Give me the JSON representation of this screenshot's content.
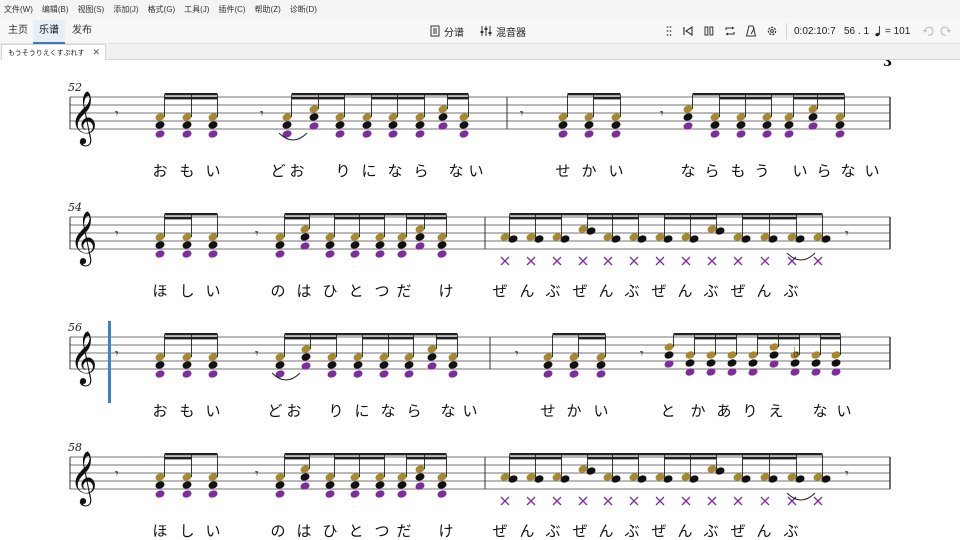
{
  "menubar": [
    "文件(W)",
    "编辑(B)",
    "视图(S)",
    "添加(J)",
    "格式(G)",
    "工具(J)",
    "插件(C)",
    "帮助(Z)",
    "诊断(D)"
  ],
  "tabs": [
    {
      "label": "主页",
      "active": false
    },
    {
      "label": "乐谱",
      "active": true
    },
    {
      "label": "发布",
      "active": false
    }
  ],
  "toolbar": {
    "parts_label": "分谱",
    "mixer_label": "混音器",
    "time": "0:02:10:7",
    "position": "56 . 1",
    "tempo": "= 101"
  },
  "document_tab": {
    "title": "もうそうりえくすぷれす"
  },
  "colors": {
    "note_black": "#111111",
    "note_olive": "#a8882e",
    "note_purple": "#7f2d9d",
    "playhead": "#3d82c7",
    "accent": "#3b78c4"
  },
  "score": {
    "page_number_partial": "3",
    "systems": [
      {
        "number": "52",
        "lyrics": [
          "お",
          "も",
          "い",
          "ど",
          "お",
          "り",
          "に",
          "な",
          "ら",
          "な",
          "い",
          "せ",
          "か",
          "い",
          "な",
          "ら",
          "も",
          "う",
          "い",
          "ら",
          "な",
          "い"
        ]
      },
      {
        "number": "54",
        "lyrics": [
          "ほ",
          "し",
          "い",
          "の",
          "は",
          "ひ",
          "と",
          "つ",
          "だ",
          "け",
          "ぜ",
          "ん",
          "ぶ",
          "ぜ",
          "ん",
          "ぶ",
          "ぜ",
          "ん",
          "ぶ",
          "ぜ",
          "ん",
          "ぶ"
        ]
      },
      {
        "number": "56",
        "lyrics": [
          "お",
          "も",
          "い",
          "ど",
          "お",
          "り",
          "に",
          "な",
          "ら",
          "な",
          "い",
          "せ",
          "か",
          "い",
          "と",
          "か",
          "あ",
          "り",
          "え",
          "な",
          "い"
        ]
      },
      {
        "number": "58",
        "lyrics": [
          "ほ",
          "し",
          "い",
          "の",
          "は",
          "ひ",
          "と",
          "つ",
          "だ",
          "け",
          "ぜ",
          "ん",
          "ぶ",
          "ぜ",
          "ん",
          "ぶ",
          "ぜ",
          "ん",
          "ぶ",
          "ぜ",
          "ん",
          "ぶ"
        ]
      }
    ]
  }
}
